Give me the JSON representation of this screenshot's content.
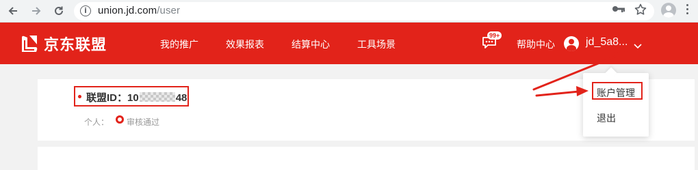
{
  "browser": {
    "url_host": "union.jd.com",
    "url_path": "/user",
    "nav_icons": [
      "back-arrow-icon",
      "forward-arrow-icon",
      "reload-icon"
    ],
    "info_icon_glyph": "i",
    "right_icons": [
      "key-icon",
      "bookmark-star-icon",
      "profile-icon",
      "menu-icon"
    ]
  },
  "header": {
    "logo_text": "京东联盟",
    "nav": [
      "我的推广",
      "效果报表",
      "结算中心",
      "工具场景"
    ],
    "message_badge": "99+",
    "help": "帮助中心",
    "username": "jd_5a8..."
  },
  "content": {
    "id_label": "联盟ID：1",
    "id_hidden": "0",
    "id_suffix": "48",
    "person_label": "个人：",
    "status": "审核通过"
  },
  "dropdown": {
    "items": [
      "账户管理",
      "退出"
    ]
  },
  "colors": {
    "brand_red": "#e2231a",
    "browser_bar": "#f1f3f4",
    "page_bg": "#f2f2f2"
  }
}
